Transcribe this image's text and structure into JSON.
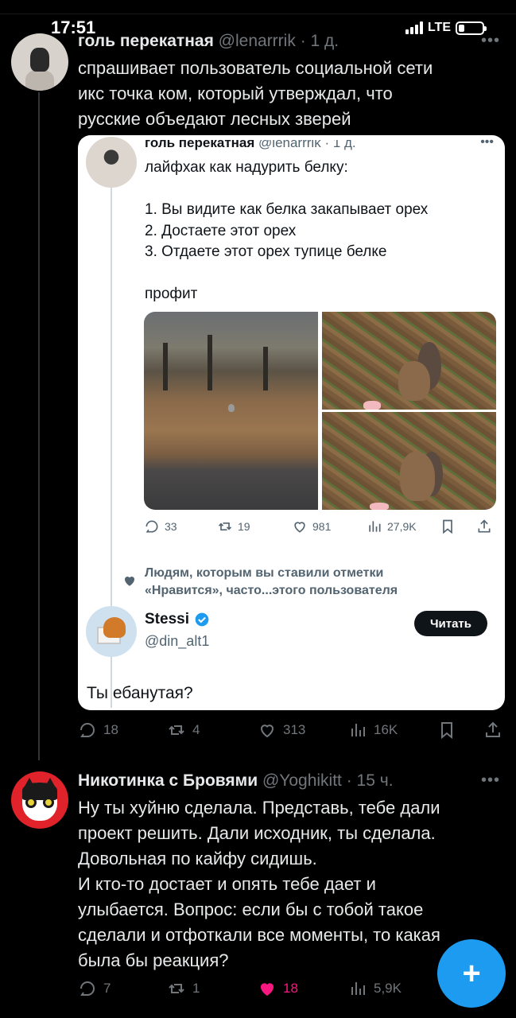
{
  "status": {
    "time": "17:51",
    "network": "LTE"
  },
  "main_tweet": {
    "name": "голь перекатная",
    "handle": "@lenarrrik",
    "age": "· 1 д.",
    "text": "спрашивает пользователь социальной сети\nикс точка ком, который утверждал, что\nрусские объедают лесных зверей",
    "quoted": {
      "name": "голь перекатная",
      "handle": "@lenarrrik",
      "age": "· 1 д.",
      "text": "лайфхак как надурить белку:\n\n1. Вы видите как белка закапывает орех\n2. Достаете этот орех\n3. Отдаете этот орех тупице белке\n\nпрофит",
      "stats": {
        "replies": "33",
        "reposts": "19",
        "likes": "981",
        "views": "27,9K"
      },
      "liked_note": "Людям, которым вы ставили отметки\n«Нравится», часто...этого пользователя",
      "reply": {
        "name": "Stessi",
        "handle": "@din_alt1",
        "follow_label": "Читать",
        "text": "Ты ебанутая?"
      }
    },
    "stats": {
      "replies": "18",
      "reposts": "4",
      "likes": "313",
      "views": "16K"
    }
  },
  "reply_tweet": {
    "name": "Никотинка с Бровями",
    "handle": "@Yoghikitt",
    "age": "· 15 ч.",
    "text": "Ну ты хуйню сделала. Представь, тебе дали\nпроект решить. Дали исходник, ты сделала.\nДовольная по кайфу сидишь.\nИ кто-то достает и опять тебе дает и\nулыбается. Вопрос: если бы с тобой такое\nсделали и отфоткали все моменты, то какая\nбыла бы реакция?",
    "stats": {
      "replies": "7",
      "reposts": "1",
      "likes": "18",
      "views": "5,9K"
    }
  },
  "icons": {
    "reply": "reply-icon",
    "repost": "repost-icon",
    "like": "heart-icon",
    "views": "views-icon",
    "bookmark": "bookmark-icon",
    "share": "share-icon",
    "verified": "verified-badge-icon",
    "compose": "compose-plus-icon"
  },
  "colors": {
    "accent": "#1d9bf0",
    "like": "#f91880",
    "muted": "#71767b",
    "background": "#000000"
  }
}
